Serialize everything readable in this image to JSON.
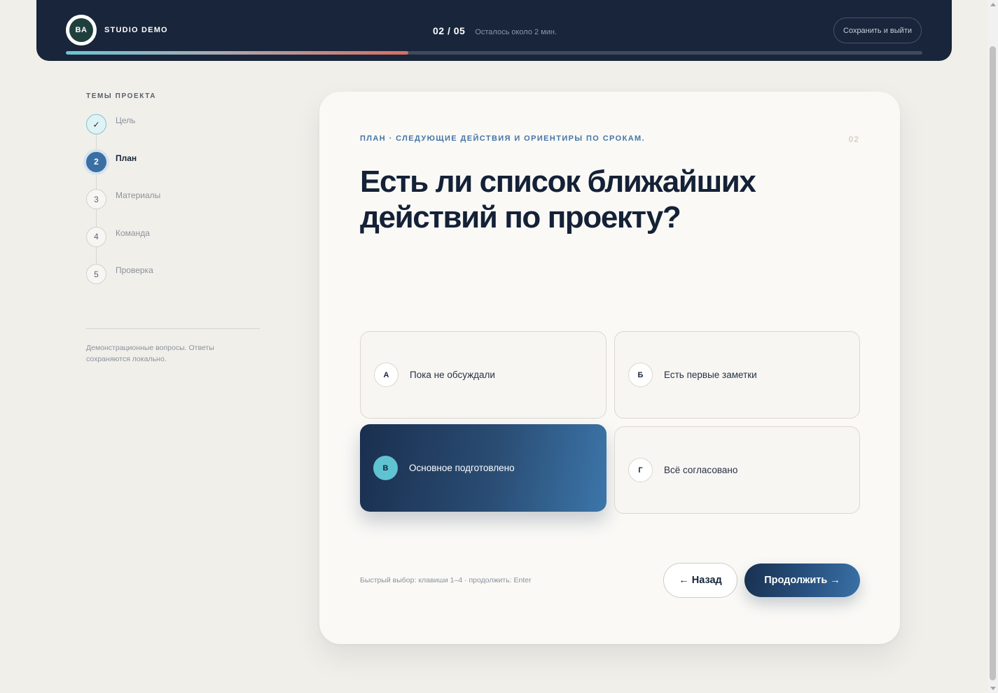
{
  "header": {
    "avatar_initials": "BA",
    "brand": "STUDIO DEMO",
    "step_count": "02 / 05",
    "time_left": "Осталось около 2 мин.",
    "save_exit_label": "Сохранить и выйти",
    "progress_fraction": 0.4
  },
  "sidebar": {
    "title": "ТЕМЫ ПРОЕКТА",
    "steps": [
      {
        "marker": "✓",
        "label": "Цель",
        "state": "done"
      },
      {
        "marker": "2",
        "label": "План",
        "state": "active"
      },
      {
        "marker": "3",
        "label": "Материалы",
        "state": "pending"
      },
      {
        "marker": "4",
        "label": "Команда",
        "state": "pending"
      },
      {
        "marker": "5",
        "label": "Проверка",
        "state": "pending"
      }
    ],
    "note": "Демонстрационные вопросы. Ответы сохраняются локально."
  },
  "card": {
    "eyebrow": "ПЛАН · СЛЕДУЮЩИЕ ДЕЙСТВИЯ И ОРИЕНТИРЫ ПО СРОКАМ.",
    "number": "02",
    "question": "Есть ли список ближайших действий по проекту?",
    "options": [
      {
        "letter": "А",
        "text": "Пока не обсуждали",
        "selected": false
      },
      {
        "letter": "Б",
        "text": "Есть первые заметки",
        "selected": false
      },
      {
        "letter": "В",
        "text": "Основное подготовлено",
        "selected": true
      },
      {
        "letter": "Г",
        "text": "Всё согласовано",
        "selected": false
      }
    ],
    "hint": "Быстрый выбор: клавиши 1–4 · продолжить: Enter",
    "back_label": "← Назад",
    "next_label": "Продолжить →"
  },
  "colors": {
    "header_bg": "#18253a",
    "accent": "#3a6fa3",
    "selected_badge": "#5fc3d1",
    "progress_end": "#d46f63"
  }
}
